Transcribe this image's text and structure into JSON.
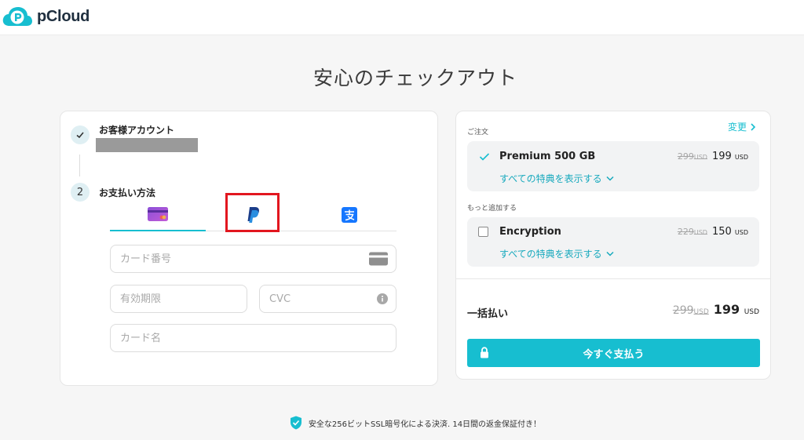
{
  "header": {
    "logo_text": "pCloud",
    "brand_color": "#17bed0"
  },
  "page": {
    "title": "安心のチェックアウト"
  },
  "steps": [
    {
      "number": "1",
      "label": "お客様アカウント",
      "status": "done",
      "icon": "check-icon"
    },
    {
      "number": "2",
      "label": "お支払い方法",
      "status": "current"
    }
  ],
  "payment_methods": [
    {
      "id": "card",
      "icon": "credit-card-icon",
      "active": true
    },
    {
      "id": "paypal",
      "icon": "paypal-icon",
      "active": false,
      "highlighted": true
    },
    {
      "id": "alipay",
      "icon": "alipay-icon",
      "active": false
    }
  ],
  "card_form": {
    "card_number_placeholder": "カード番号",
    "expiry_placeholder": "有効期限",
    "cvc_placeholder": "CVC",
    "card_name_placeholder": "カード名"
  },
  "order": {
    "section_label": "ご注文",
    "change_label": "変更",
    "items": [
      {
        "name": "Premium 500 GB",
        "old_price": "299",
        "old_currency": "USD",
        "price": "199",
        "currency": "USD",
        "benefits_label": "すべての特典を表示する",
        "selected": true
      }
    ]
  },
  "addons": {
    "section_label": "もっと追加する",
    "items": [
      {
        "name": "Encryption",
        "old_price": "229",
        "old_currency": "USD",
        "price": "150",
        "currency": "USD",
        "benefits_label": "すべての特典を表示する",
        "selected": false
      }
    ]
  },
  "total": {
    "label": "一括払い",
    "old_price": "299",
    "old_currency": "USD",
    "price": "199",
    "currency": "USD"
  },
  "pay_button_label": "今すぐ支払う",
  "footer": {
    "text": "安全な256ビットSSL暗号化による決済. 14日間の返金保証付き！"
  }
}
